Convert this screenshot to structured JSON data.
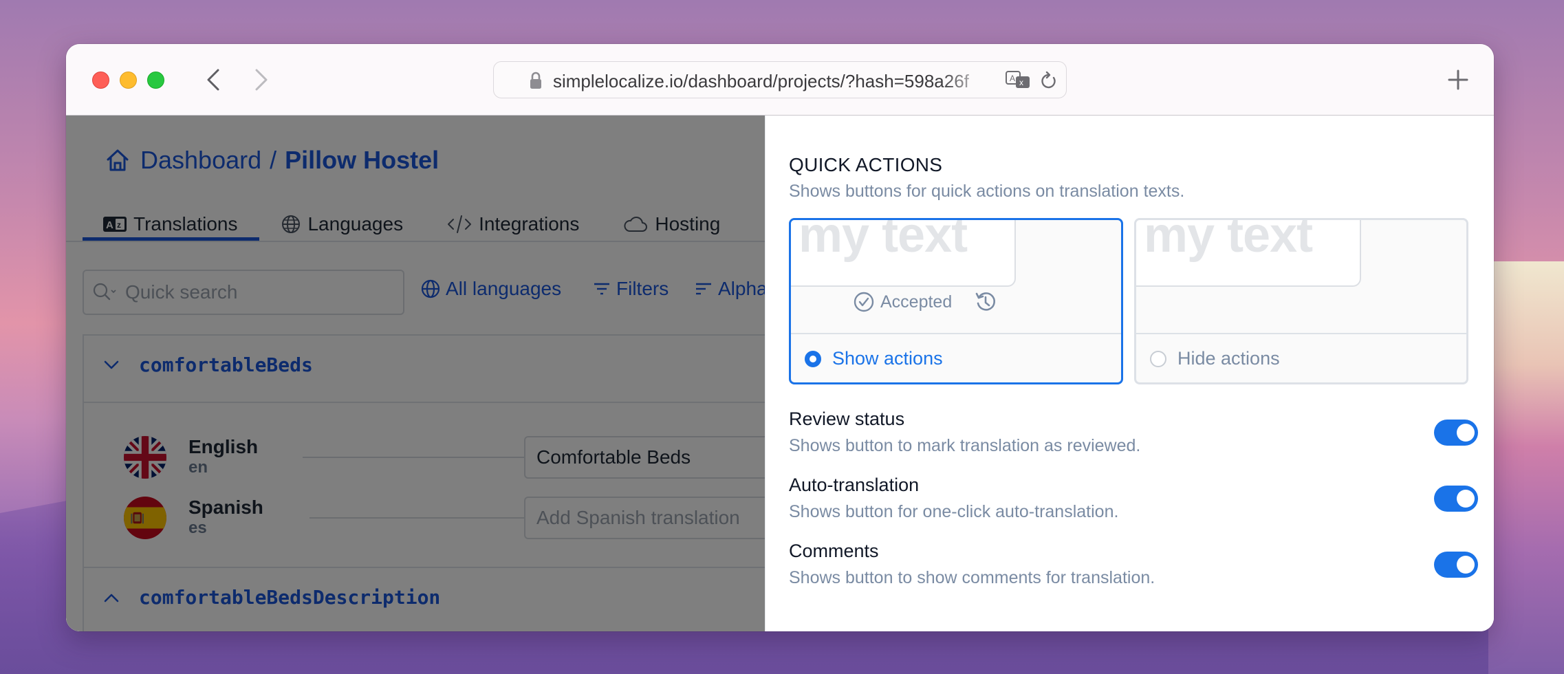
{
  "browser": {
    "url": "simplelocalize.io/dashboard/projects/?hash=598a26f",
    "back_enabled": true,
    "forward_enabled": false
  },
  "header": {
    "breadcrumb_root": "Dashboard",
    "breadcrumb_separator": "/",
    "breadcrumb_current": "Pillow Hostel"
  },
  "tabs": [
    {
      "label": "Translations",
      "icon": "translate-az-icon",
      "active": true
    },
    {
      "label": "Languages",
      "icon": "globe-icon",
      "active": false
    },
    {
      "label": "Integrations",
      "icon": "code-icon",
      "active": false
    },
    {
      "label": "Hosting",
      "icon": "cloud-icon",
      "active": false
    }
  ],
  "toolbar": {
    "search_placeholder": "Quick search",
    "all_languages": "All languages",
    "filters": "Filters",
    "sort": "Alphabetical"
  },
  "keys": [
    {
      "name": "comfortableBeds",
      "expanded": true,
      "translations": [
        {
          "language": "English",
          "code": "en",
          "value": "Comfortable Beds",
          "placeholder": ""
        },
        {
          "language": "Spanish",
          "code": "es",
          "value": "",
          "placeholder": "Add Spanish translation"
        }
      ]
    },
    {
      "name": "comfortableBedsDescription",
      "expanded": false,
      "translations": []
    }
  ],
  "panel": {
    "title": "QUICK ACTIONS",
    "description": "Shows buttons for quick actions on translation texts.",
    "preview_text": "my text",
    "accepted_label": "Accepted",
    "options": [
      {
        "label": "Show actions",
        "selected": true
      },
      {
        "label": "Hide actions",
        "selected": false
      }
    ],
    "settings": [
      {
        "title": "Review status",
        "description": "Shows button to mark translation as reviewed.",
        "enabled": true
      },
      {
        "title": "Auto-translation",
        "description": "Shows button for one-click auto-translation.",
        "enabled": true
      },
      {
        "title": "Comments",
        "description": "Shows button to show comments for translation.",
        "enabled": true
      }
    ]
  },
  "colors": {
    "accent": "#1a73e8",
    "link": "#1a56db",
    "muted_text": "#7a8ba3"
  }
}
